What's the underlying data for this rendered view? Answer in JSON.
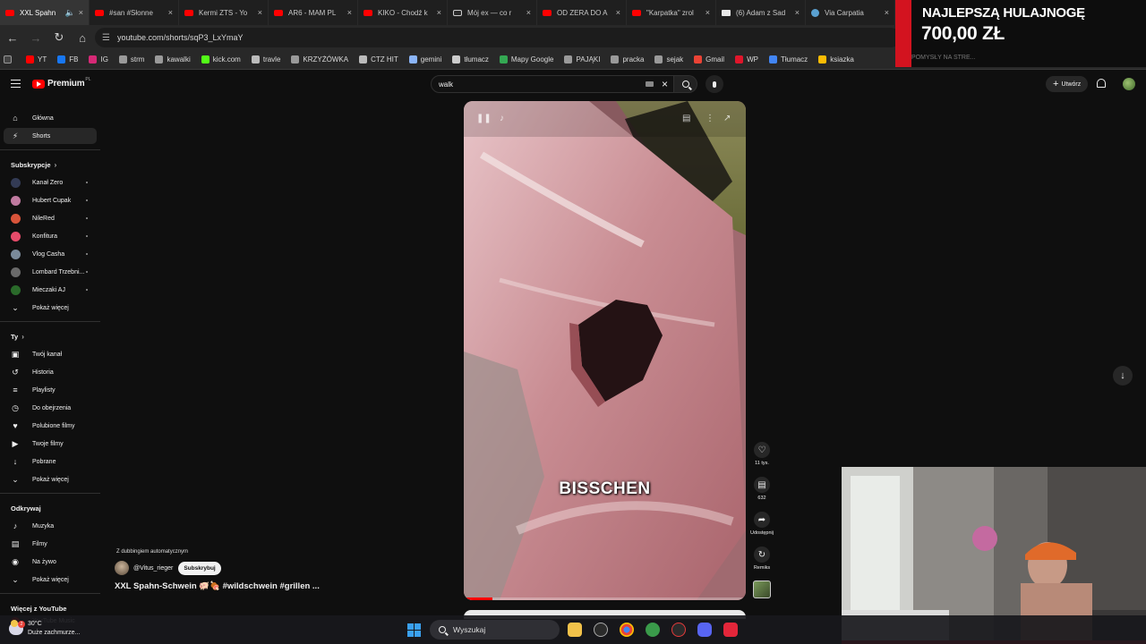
{
  "browser": {
    "tabs": [
      {
        "title": "XXL Spahn",
        "icon": "youtube-icon",
        "active": true
      },
      {
        "title": "#san #Słonne",
        "icon": "youtube-icon"
      },
      {
        "title": "Kermi ZTS - Yo",
        "icon": "youtube-icon"
      },
      {
        "title": "AR6 - MAM PL",
        "icon": "youtube-icon"
      },
      {
        "title": "KIKO - Chodź k",
        "icon": "youtube-icon"
      },
      {
        "title": "Mój ex — co r",
        "icon": "tiktok-icon"
      },
      {
        "title": "OD ZERA DO A",
        "icon": "youtube-icon"
      },
      {
        "title": "\"Karpatka\" zrol",
        "icon": "youtube-icon"
      },
      {
        "title": "(6) Adam z Sad",
        "icon": "x-icon"
      },
      {
        "title": "Via Carpatia",
        "icon": "globe-icon"
      }
    ],
    "url": "youtube.com/shorts/sqP3_LxYmaY",
    "bookmarks": [
      {
        "label": "YT",
        "color": "#ff0000"
      },
      {
        "label": "FB",
        "color": "#1877f2"
      },
      {
        "label": "IG",
        "color": "#d62976"
      },
      {
        "label": "strm",
        "color": "#9a9a9a"
      },
      {
        "label": "kawalki",
        "color": "#9a9a9a"
      },
      {
        "label": "kick.com",
        "color": "#53fc18"
      },
      {
        "label": "travle",
        "color": "#bbbbbb"
      },
      {
        "label": "KRZYŻÓWKA",
        "color": "#9a9a9a"
      },
      {
        "label": "CTZ HIT",
        "color": "#bbbbbb"
      },
      {
        "label": "gemini",
        "color": "#8ab4f8"
      },
      {
        "label": "tłumacz",
        "color": "#cccccc"
      },
      {
        "label": "Mapy Google",
        "color": "#34a853"
      },
      {
        "label": "PAJĄKI",
        "color": "#9a9a9a"
      },
      {
        "label": "pracka",
        "color": "#9a9a9a"
      },
      {
        "label": "sejak",
        "color": "#9a9a9a"
      },
      {
        "label": "Gmail",
        "color": "#ea4335"
      },
      {
        "label": "WP",
        "color": "#e0162b"
      },
      {
        "label": "Tłumacz",
        "color": "#4285f4"
      },
      {
        "label": "ksiazka",
        "color": "#fbbc04"
      }
    ]
  },
  "youtube": {
    "logo": "Premium",
    "logo_country": "PL",
    "search_value": "walk",
    "create_label": "Utwórz",
    "sidebar": {
      "main": [
        {
          "label": "Główna",
          "icon": "home-icon"
        },
        {
          "label": "Shorts",
          "icon": "shorts-icon",
          "active": true
        }
      ],
      "subs_header": "Subskrypcje",
      "subs": [
        {
          "label": "Kanał Zero",
          "color": "#333b55"
        },
        {
          "label": "Hubert Cupak",
          "color": "#c07aa0"
        },
        {
          "label": "NileRed",
          "color": "#d8543a"
        },
        {
          "label": "Konfitura",
          "color": "#e64b6a"
        },
        {
          "label": "Vlog Casha",
          "color": "#7a8a9a"
        },
        {
          "label": "Lombard Trzebni...",
          "color": "#6a6a6a"
        },
        {
          "label": "Mieczaki AJ",
          "color": "#2a6a2a"
        }
      ],
      "show_more": "Pokaż więcej",
      "you_header": "Ty",
      "you": [
        {
          "label": "Twój kanał",
          "icon": "channel-icon"
        },
        {
          "label": "Historia",
          "icon": "history-icon"
        },
        {
          "label": "Playlisty",
          "icon": "playlists-icon"
        },
        {
          "label": "Do obejrzenia",
          "icon": "watch-later-icon"
        },
        {
          "label": "Polubione filmy",
          "icon": "like-icon"
        },
        {
          "label": "Twoje filmy",
          "icon": "your-videos-icon"
        },
        {
          "label": "Pobrane",
          "icon": "download-icon"
        },
        {
          "label": "Pokaż więcej",
          "icon": "chevron-down-icon"
        }
      ],
      "explore_header": "Odkrywaj",
      "explore": [
        {
          "label": "Muzyka",
          "icon": "music-icon"
        },
        {
          "label": "Filmy",
          "icon": "film-icon"
        },
        {
          "label": "Na żywo",
          "icon": "live-icon"
        },
        {
          "label": "Pokaż więcej",
          "icon": "chevron-down-icon"
        }
      ],
      "more_header": "Więcej z YouTube",
      "more_partial": "YouTube Music"
    },
    "short": {
      "caption": "BISSCHEN",
      "dub_label": "Z dubbingiem automatycznym",
      "channel": "@Vitus_rieger",
      "subscribe": "Subskrybuj",
      "title": "XXL Spahn-Schwein 🐖🍖 #wildschwein #grillen ...",
      "progress": 0.1,
      "actions": [
        {
          "icon": "like-icon",
          "label": "11 tys."
        },
        {
          "icon": "comment-icon",
          "label": "632"
        },
        {
          "icon": "share-icon",
          "label": "Udostępnij"
        },
        {
          "icon": "remix-icon",
          "label": "Remiks"
        }
      ]
    }
  },
  "promo": {
    "line1": "NAJLEPSZĄ HULAJNOGĘ",
    "line2": "700,00 ZŁ",
    "line3": "POMYSŁY NA STRE..."
  },
  "taskbar": {
    "weather_temp": "30°C",
    "weather_desc": "Duże zachmurze...",
    "weather_badge": "2",
    "search_label": "Wyszukaj"
  }
}
